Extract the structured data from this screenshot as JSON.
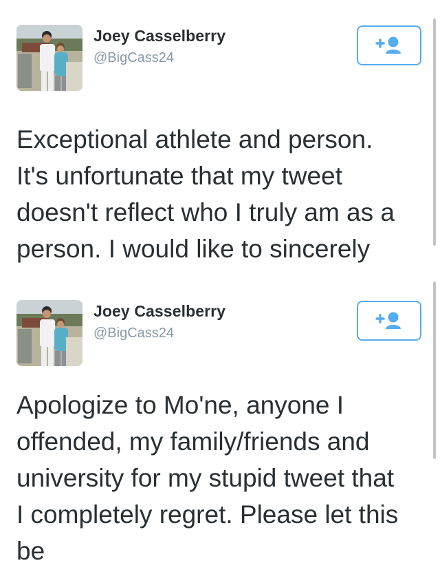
{
  "tweets": [
    {
      "display_name": "Joey Casselberry",
      "handle": "@BigCass24",
      "text": "Exceptional athlete and person.\nIt's unfortunate that my tweet\ndoesn't reflect who I truly am as a\nperson. I would like to sincerely",
      "follow_icon": "follow-person-plus-icon"
    },
    {
      "display_name": "Joey Casselberry",
      "handle": "@BigCass24",
      "text": "Apologize to Mo'ne, anyone I\noffended, my family/friends and\nuniversity for my stupid tweet that\nI completely regret. Please let this\nbe",
      "follow_icon": "follow-person-plus-icon"
    }
  ],
  "colors": {
    "accent": "#55acee",
    "text": "#292f33",
    "secondary": "#8899a6"
  }
}
